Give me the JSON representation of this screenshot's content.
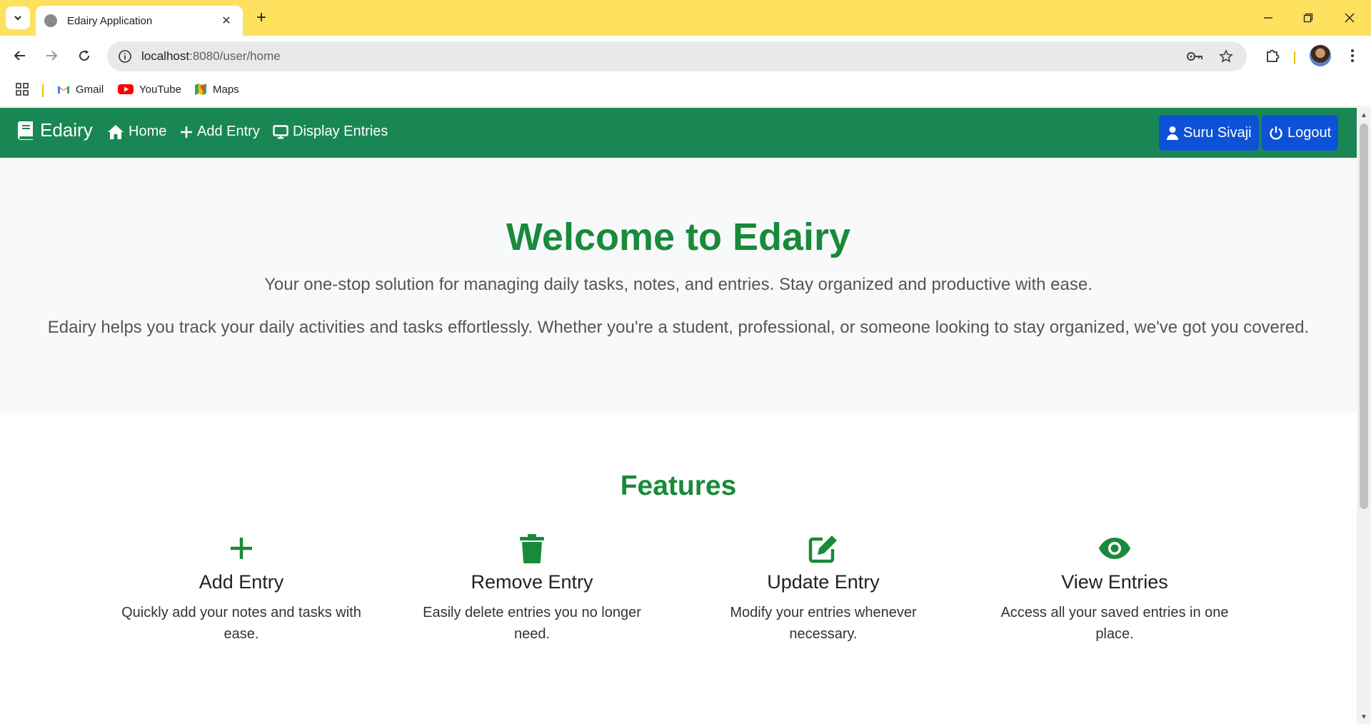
{
  "browser": {
    "tab_title": "Edairy Application",
    "url_host": "localhost",
    "url_path": ":8080/user/home",
    "bookmarks": [
      {
        "label": "Gmail",
        "icon": "gmail-icon"
      },
      {
        "label": "YouTube",
        "icon": "youtube-icon"
      },
      {
        "label": "Maps",
        "icon": "maps-icon"
      }
    ],
    "chrome_color": "#fde15f"
  },
  "navbar": {
    "brand": "Edairy",
    "links": [
      {
        "label": "Home",
        "icon": "home-icon"
      },
      {
        "label": "Add Entry",
        "icon": "plus-icon"
      },
      {
        "label": "Display Entries",
        "icon": "monitor-icon"
      }
    ],
    "user_button": "Suru Sivaji",
    "logout_button": "Logout",
    "navbar_color": "#198754",
    "button_color": "#0d52d6"
  },
  "hero": {
    "title": "Welcome to Edairy",
    "lead": "Your one-stop solution for managing daily tasks, notes, and entries. Stay organized and productive with ease.",
    "sub": "Edairy helps you track your daily activities and tasks effortlessly. Whether you're a student, professional, or someone looking to stay organized, we've got you covered."
  },
  "features": {
    "heading": "Features",
    "accent_color": "#198a3a",
    "items": [
      {
        "title": "Add Entry",
        "text": "Quickly add your notes and tasks with ease.",
        "icon": "plus-icon"
      },
      {
        "title": "Remove Entry",
        "text": "Easily delete entries you no longer need.",
        "icon": "trash-icon"
      },
      {
        "title": "Update Entry",
        "text": "Modify your entries whenever necessary.",
        "icon": "edit-icon"
      },
      {
        "title": "View Entries",
        "text": "Access all your saved entries in one place.",
        "icon": "eye-icon"
      }
    ]
  }
}
